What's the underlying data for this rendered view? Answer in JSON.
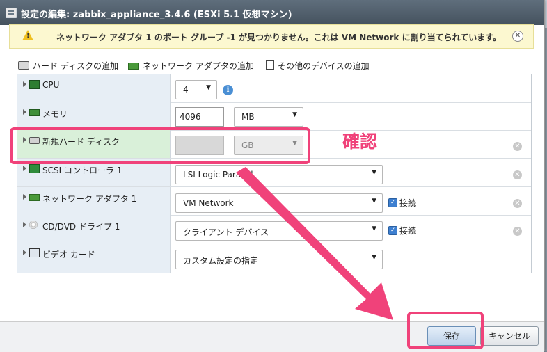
{
  "window": {
    "title": "設定の編集: zabbix_appliance_3.4.6 (ESXi 5.1 仮想マシン)"
  },
  "warning": {
    "text": "ネットワーク アダプタ 1 のポート グループ -1 が見つかりません。これは VM Network に割り当てられています。",
    "icon": "warning-triangle-icon",
    "close_icon": "close-icon"
  },
  "toolbar": {
    "add_hdd": "ハード ディスクの追加",
    "add_nic": "ネットワーク アダプタの追加",
    "add_other": "その他のデバイスの追加"
  },
  "rows": [
    {
      "label": "CPU",
      "value": "4",
      "icon": "cpu-icon"
    },
    {
      "label": "メモリ",
      "value": "4096",
      "unit": "MB",
      "icon": "memory-icon"
    },
    {
      "label": "新規ハード ディスク",
      "value": "",
      "unit": "GB",
      "icon": "hard-disk-icon"
    },
    {
      "label": "SCSI コントローラ 1",
      "value": "LSI Logic Parallel",
      "icon": "scsi-icon"
    },
    {
      "label": "ネットワーク アダプタ 1",
      "value": "VM Network",
      "connect_label": "接続",
      "icon": "network-adapter-icon"
    },
    {
      "label": "CD/DVD ドライブ 1",
      "value": "クライアント デバイス",
      "connect_label": "接続",
      "icon": "cd-dvd-icon"
    },
    {
      "label": "ビデオ カード",
      "value": "カスタム設定の指定",
      "icon": "video-card-icon"
    }
  ],
  "annotation": {
    "text": "確認",
    "color": "#f0427a"
  },
  "footer": {
    "save_label": "保存",
    "cancel_label": "キャンセル"
  }
}
